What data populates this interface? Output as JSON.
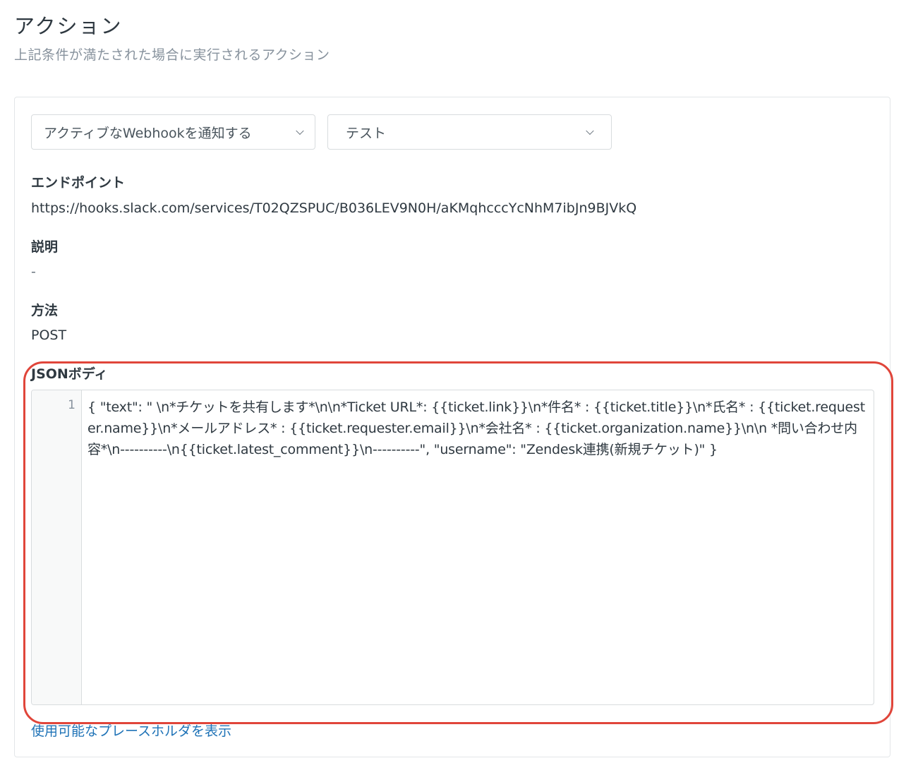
{
  "header": {
    "title": "アクション",
    "subtitle": "上記条件が満たされた場合に実行されるアクション"
  },
  "action": {
    "type_select": "アクティブなWebhookを通知する",
    "target_select": "テスト"
  },
  "endpoint": {
    "label": "エンドポイント",
    "value": "https://hooks.slack.com/services/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"
  },
  "description": {
    "label": "説明",
    "value": "-"
  },
  "method": {
    "label": "方法",
    "value": "POST"
  },
  "json_body": {
    "label": "JSONボディ",
    "line_number": "1",
    "code": "{ \"text\": \" \\n*チケットを共有します*\\n\\n*Ticket URL*: {{ticket.link}}\\n*件名* : {{ticket.title}}\\n*氏名* : {{ticket.requester.name}}\\n*メールアドレス* : {{ticket.requester.email}}\\n*会社名* : {{ticket.organization.name}}\\n\\n *問い合わせ内容*\\n----------\\n{{ticket.latest_comment}}\\n----------\", \"username\": \"Zendesk連携(新規チケット)\" }"
  },
  "placeholder_link": "使用可能なプレースホルダを表示",
  "colors": {
    "highlight": "#e0453a",
    "link": "#1f73b7"
  }
}
